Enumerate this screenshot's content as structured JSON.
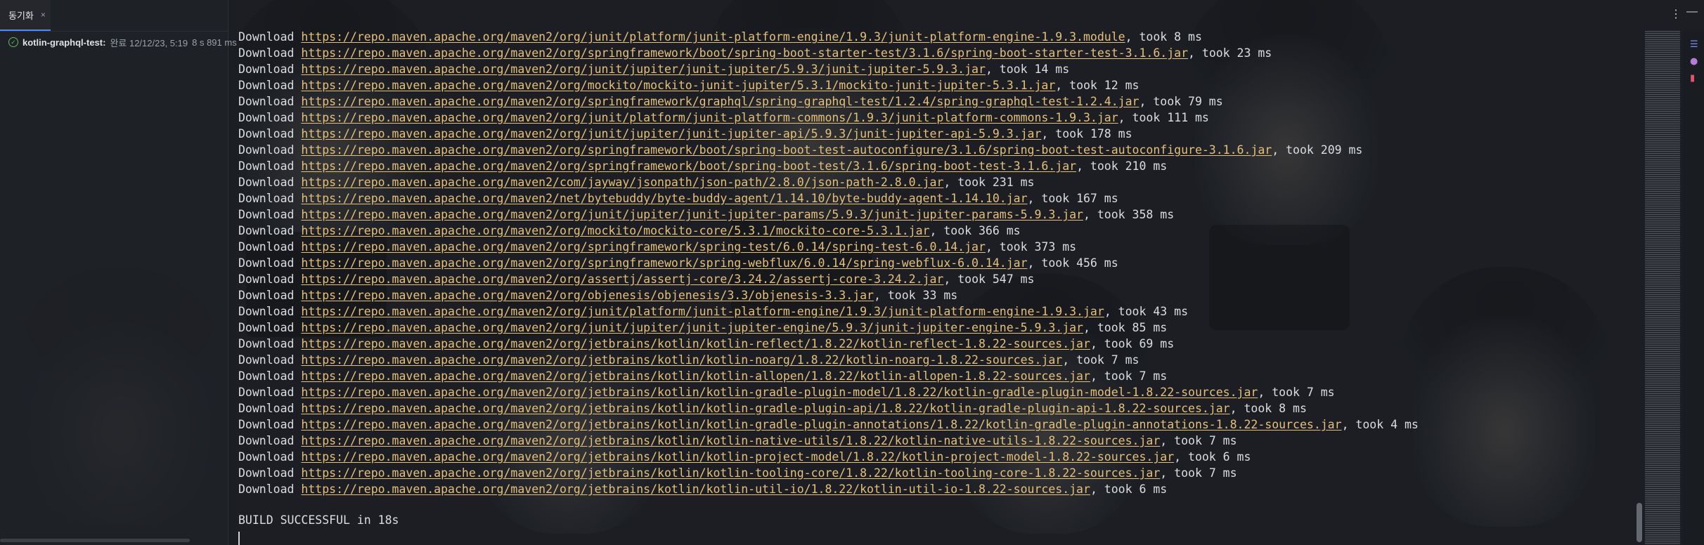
{
  "left_panel": {
    "tab_label": "동기화",
    "tab_close": "×",
    "build_item": {
      "name": "kotlin-graphql-test:",
      "status": " 완료 12/12/23, 5:19",
      "duration": "8 s 891 ms"
    }
  },
  "console": {
    "lines": [
      {
        "prefix": "Download ",
        "url": "https://repo.maven.apache.org/maven2/org/junit/platform/junit-platform-engine/1.9.3/junit-platform-engine-1.9.3.module",
        "suffix": ", took 8 ms"
      },
      {
        "prefix": "Download ",
        "url": "https://repo.maven.apache.org/maven2/org/springframework/boot/spring-boot-starter-test/3.1.6/spring-boot-starter-test-3.1.6.jar",
        "suffix": ", took 23 ms"
      },
      {
        "prefix": "Download ",
        "url": "https://repo.maven.apache.org/maven2/org/junit/jupiter/junit-jupiter/5.9.3/junit-jupiter-5.9.3.jar",
        "suffix": ", took 14 ms"
      },
      {
        "prefix": "Download ",
        "url": "https://repo.maven.apache.org/maven2/org/mockito/mockito-junit-jupiter/5.3.1/mockito-junit-jupiter-5.3.1.jar",
        "suffix": ", took 12 ms"
      },
      {
        "prefix": "Download ",
        "url": "https://repo.maven.apache.org/maven2/org/springframework/graphql/spring-graphql-test/1.2.4/spring-graphql-test-1.2.4.jar",
        "suffix": ", took 79 ms"
      },
      {
        "prefix": "Download ",
        "url": "https://repo.maven.apache.org/maven2/org/junit/platform/junit-platform-commons/1.9.3/junit-platform-commons-1.9.3.jar",
        "suffix": ", took 111 ms"
      },
      {
        "prefix": "Download ",
        "url": "https://repo.maven.apache.org/maven2/org/junit/jupiter/junit-jupiter-api/5.9.3/junit-jupiter-api-5.9.3.jar",
        "suffix": ", took 178 ms"
      },
      {
        "prefix": "Download ",
        "url": "https://repo.maven.apache.org/maven2/org/springframework/boot/spring-boot-test-autoconfigure/3.1.6/spring-boot-test-autoconfigure-3.1.6.jar",
        "suffix": ", took 209 ms"
      },
      {
        "prefix": "Download ",
        "url": "https://repo.maven.apache.org/maven2/org/springframework/boot/spring-boot-test/3.1.6/spring-boot-test-3.1.6.jar",
        "suffix": ", took 210 ms"
      },
      {
        "prefix": "Download ",
        "url": "https://repo.maven.apache.org/maven2/com/jayway/jsonpath/json-path/2.8.0/json-path-2.8.0.jar",
        "suffix": ", took 231 ms"
      },
      {
        "prefix": "Download ",
        "url": "https://repo.maven.apache.org/maven2/net/bytebuddy/byte-buddy-agent/1.14.10/byte-buddy-agent-1.14.10.jar",
        "suffix": ", took 167 ms"
      },
      {
        "prefix": "Download ",
        "url": "https://repo.maven.apache.org/maven2/org/junit/jupiter/junit-jupiter-params/5.9.3/junit-jupiter-params-5.9.3.jar",
        "suffix": ", took 358 ms"
      },
      {
        "prefix": "Download ",
        "url": "https://repo.maven.apache.org/maven2/org/mockito/mockito-core/5.3.1/mockito-core-5.3.1.jar",
        "suffix": ", took 366 ms"
      },
      {
        "prefix": "Download ",
        "url": "https://repo.maven.apache.org/maven2/org/springframework/spring-test/6.0.14/spring-test-6.0.14.jar",
        "suffix": ", took 373 ms"
      },
      {
        "prefix": "Download ",
        "url": "https://repo.maven.apache.org/maven2/org/springframework/spring-webflux/6.0.14/spring-webflux-6.0.14.jar",
        "suffix": ", took 456 ms"
      },
      {
        "prefix": "Download ",
        "url": "https://repo.maven.apache.org/maven2/org/assertj/assertj-core/3.24.2/assertj-core-3.24.2.jar",
        "suffix": ", took 547 ms"
      },
      {
        "prefix": "Download ",
        "url": "https://repo.maven.apache.org/maven2/org/objenesis/objenesis/3.3/objenesis-3.3.jar",
        "suffix": ", took 33 ms"
      },
      {
        "prefix": "Download ",
        "url": "https://repo.maven.apache.org/maven2/org/junit/platform/junit-platform-engine/1.9.3/junit-platform-engine-1.9.3.jar",
        "suffix": ", took 43 ms"
      },
      {
        "prefix": "Download ",
        "url": "https://repo.maven.apache.org/maven2/org/junit/jupiter/junit-jupiter-engine/5.9.3/junit-jupiter-engine-5.9.3.jar",
        "suffix": ", took 85 ms"
      },
      {
        "prefix": "Download ",
        "url": "https://repo.maven.apache.org/maven2/org/jetbrains/kotlin/kotlin-reflect/1.8.22/kotlin-reflect-1.8.22-sources.jar",
        "suffix": ", took 69 ms"
      },
      {
        "prefix": "Download ",
        "url": "https://repo.maven.apache.org/maven2/org/jetbrains/kotlin/kotlin-noarg/1.8.22/kotlin-noarg-1.8.22-sources.jar",
        "suffix": ", took 7 ms"
      },
      {
        "prefix": "Download ",
        "url": "https://repo.maven.apache.org/maven2/org/jetbrains/kotlin/kotlin-allopen/1.8.22/kotlin-allopen-1.8.22-sources.jar",
        "suffix": ", took 7 ms"
      },
      {
        "prefix": "Download ",
        "url": "https://repo.maven.apache.org/maven2/org/jetbrains/kotlin/kotlin-gradle-plugin-model/1.8.22/kotlin-gradle-plugin-model-1.8.22-sources.jar",
        "suffix": ", took 7 ms"
      },
      {
        "prefix": "Download ",
        "url": "https://repo.maven.apache.org/maven2/org/jetbrains/kotlin/kotlin-gradle-plugin-api/1.8.22/kotlin-gradle-plugin-api-1.8.22-sources.jar",
        "suffix": ", took 8 ms"
      },
      {
        "prefix": "Download ",
        "url": "https://repo.maven.apache.org/maven2/org/jetbrains/kotlin/kotlin-gradle-plugin-annotations/1.8.22/kotlin-gradle-plugin-annotations-1.8.22-sources.jar",
        "suffix": ", took 4 ms"
      },
      {
        "prefix": "Download ",
        "url": "https://repo.maven.apache.org/maven2/org/jetbrains/kotlin/kotlin-native-utils/1.8.22/kotlin-native-utils-1.8.22-sources.jar",
        "suffix": ", took 7 ms"
      },
      {
        "prefix": "Download ",
        "url": "https://repo.maven.apache.org/maven2/org/jetbrains/kotlin/kotlin-project-model/1.8.22/kotlin-project-model-1.8.22-sources.jar",
        "suffix": ", took 6 ms"
      },
      {
        "prefix": "Download ",
        "url": "https://repo.maven.apache.org/maven2/org/jetbrains/kotlin/kotlin-tooling-core/1.8.22/kotlin-tooling-core-1.8.22-sources.jar",
        "suffix": ", took 7 ms"
      },
      {
        "prefix": "Download ",
        "url": "https://repo.maven.apache.org/maven2/org/jetbrains/kotlin/kotlin-util-io/1.8.22/kotlin-util-io-1.8.22-sources.jar",
        "suffix": ", took 6 ms"
      }
    ],
    "build_result": "BUILD SUCCESSFUL in 18s"
  },
  "controls": {
    "more_icon": "⋮",
    "minimize_icon": "—"
  },
  "colors": {
    "url": "#e5c07b",
    "success": "#5fb85f",
    "text": "#dadde2"
  },
  "icons": {
    "status": "check-circle-icon",
    "more": "more-vertical-icon",
    "minimize": "minimize-icon",
    "side_toolbar": [
      "list-icon",
      "avatar-icon",
      "trash-icon"
    ]
  }
}
